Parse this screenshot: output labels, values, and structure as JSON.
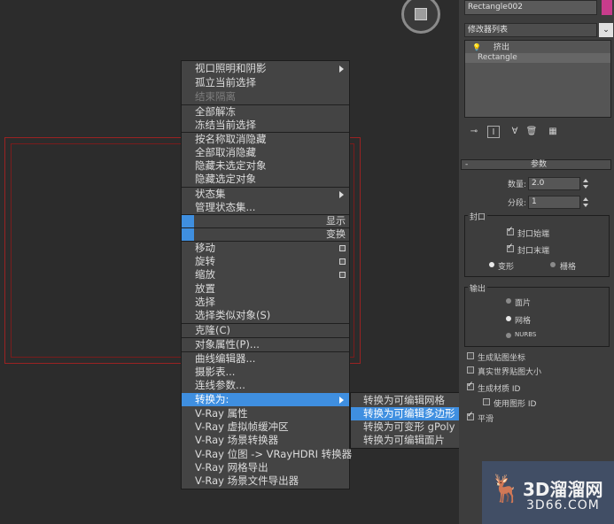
{
  "context_menu": {
    "items": [
      {
        "label": "视口照明和阴影",
        "state": "normal",
        "submenu": true
      },
      {
        "label": "孤立当前选择",
        "state": "normal"
      },
      {
        "label": "结束隔离",
        "state": "disabled"
      },
      {
        "label": "全部解冻",
        "state": "normal"
      },
      {
        "label": "冻结当前选择",
        "state": "normal"
      },
      {
        "label": "按名称取消隐藏",
        "state": "normal"
      },
      {
        "label": "全部取消隐藏",
        "state": "normal"
      },
      {
        "label": "隐藏未选定对象",
        "state": "normal"
      },
      {
        "label": "隐藏选定对象",
        "state": "normal"
      },
      {
        "label": "状态集",
        "state": "normal",
        "submenu": true
      },
      {
        "label": "管理状态集...",
        "state": "normal"
      },
      {
        "label": "显示",
        "state": "quad-title"
      },
      {
        "label": "变换",
        "state": "quad-title"
      },
      {
        "label": "移动",
        "state": "normal"
      },
      {
        "label": "旋转",
        "state": "normal"
      },
      {
        "label": "缩放",
        "state": "normal"
      },
      {
        "label": "放置",
        "state": "normal"
      },
      {
        "label": "选择",
        "state": "normal"
      },
      {
        "label": "选择类似对象(S)",
        "state": "normal"
      },
      {
        "label": "克隆(C)",
        "state": "normal"
      },
      {
        "label": "对象属性(P)...",
        "state": "normal"
      },
      {
        "label": "曲线编辑器...",
        "state": "normal"
      },
      {
        "label": "摄影表...",
        "state": "normal"
      },
      {
        "label": "连线参数...",
        "state": "normal"
      },
      {
        "label": "转换为:",
        "state": "highlighted",
        "submenu": true
      },
      {
        "label": "V-Ray 属性",
        "state": "normal"
      },
      {
        "label": "V-Ray 虚拟帧缓冲区",
        "state": "normal"
      },
      {
        "label": "V-Ray 场景转换器",
        "state": "normal"
      },
      {
        "label": "V-Ray 位图 -> VRayHDRI 转换器",
        "state": "normal"
      },
      {
        "label": "V-Ray 网格导出",
        "state": "normal"
      },
      {
        "label": "V-Ray 场景文件导出器",
        "state": "normal"
      }
    ]
  },
  "convert_submenu": {
    "items": [
      {
        "label": "转换为可编辑网格",
        "state": "normal"
      },
      {
        "label": "转换为可编辑多边形",
        "state": "highlighted"
      },
      {
        "label": "转换为可变形 gPoly",
        "state": "normal"
      },
      {
        "label": "转换为可编辑面片",
        "state": "normal"
      }
    ]
  },
  "command_panel": {
    "object_name": "Rectangle002",
    "modifier_list_label": "修改器列表",
    "stack": [
      "挤出",
      "Rectangle"
    ],
    "params_title": "参数",
    "amount_label": "数量:",
    "amount_value": "2.0",
    "segments_label": "分段:",
    "segments_value": "1",
    "capping_title": "封口",
    "cap_start": "封口始端",
    "cap_end": "封口末端",
    "morph": "变形",
    "grid": "栅格",
    "output_title": "输出",
    "patch": "面片",
    "mesh": "网格",
    "nurbs": "NURBS",
    "gen_map_coords": "生成贴图坐标",
    "real_world_map": "真实世界贴图大小",
    "gen_mat_ids": "生成材质 ID",
    "use_shape_ids": "使用图形 ID",
    "smooth": "平滑"
  },
  "watermark": {
    "brand": "3D溜溜网",
    "url": "3D66.COM"
  },
  "colors": {
    "highlight": "#3f8fe0",
    "frame": "#9a2222",
    "object_color": "#c83c8c"
  }
}
